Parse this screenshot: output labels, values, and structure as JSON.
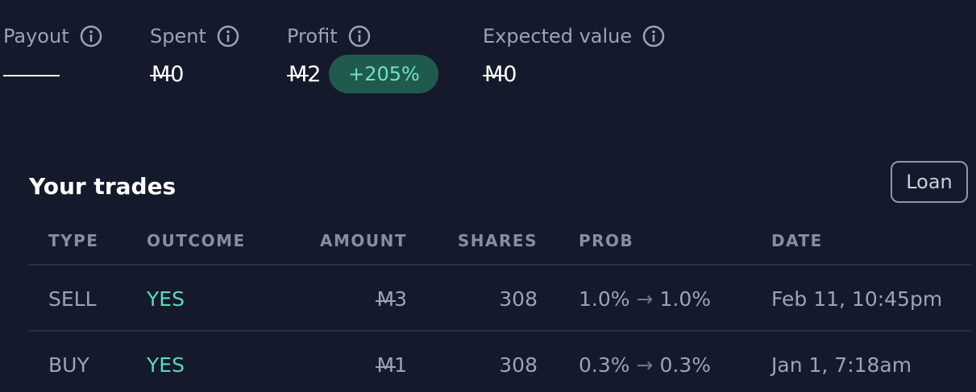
{
  "stats": {
    "payout": {
      "label": "Payout",
      "value": "——"
    },
    "spent": {
      "label": "Spent",
      "currency": "M",
      "value": "0"
    },
    "profit": {
      "label": "Profit",
      "currency": "M",
      "value": "2",
      "badge": "+205%"
    },
    "expected": {
      "label": "Expected value",
      "currency": "M",
      "value": "0"
    }
  },
  "trades": {
    "title": "Your trades",
    "loan_label": "Loan",
    "columns": {
      "type": "TYPE",
      "outcome": "OUTCOME",
      "amount": "AMOUNT",
      "shares": "SHARES",
      "prob": "PROB",
      "date": "DATE"
    },
    "rows": [
      {
        "type": "SELL",
        "outcome": "YES",
        "currency": "M",
        "amount": "3",
        "shares": "308",
        "prob_from": "1.0%",
        "arrow": "→",
        "prob_to": "1.0%",
        "date": "Feb 11, 10:45pm"
      },
      {
        "type": "BUY",
        "outcome": "YES",
        "currency": "M",
        "amount": "1",
        "shares": "308",
        "prob_from": "0.3%",
        "arrow": "→",
        "prob_to": "0.3%",
        "date": "Jan 1, 7:18am"
      }
    ]
  },
  "colors": {
    "background": "#141a2b",
    "muted_text": "#9ba3b8",
    "accent_green": "#5fd9b8",
    "badge_bg": "#205a4e",
    "divider": "#283044"
  },
  "icons": {
    "info": "info-circle-icon"
  }
}
